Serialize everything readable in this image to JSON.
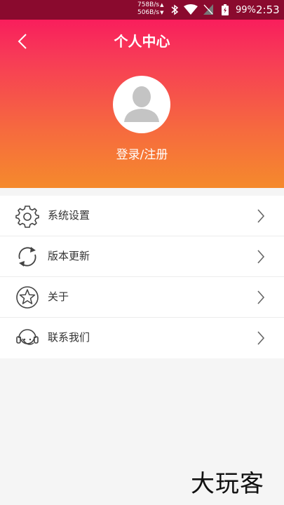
{
  "status_bar": {
    "net_up": "758B/s",
    "net_down": "506B/s",
    "battery": "99%",
    "time": "2:53"
  },
  "header": {
    "title": "个人中心",
    "login_label": "登录/注册"
  },
  "menu": {
    "items": [
      {
        "label": "系统设置",
        "icon": "gear-icon"
      },
      {
        "label": "版本更新",
        "icon": "refresh-icon"
      },
      {
        "label": "关于",
        "icon": "star-icon"
      },
      {
        "label": "联系我们",
        "icon": "headset-icon"
      }
    ]
  },
  "watermark": "大玩客",
  "colors": {
    "header_top": "#fa0f5f",
    "header_bottom": "#f58a2c",
    "status_bar": "#8a0a2e",
    "background": "#f5f5f5"
  }
}
